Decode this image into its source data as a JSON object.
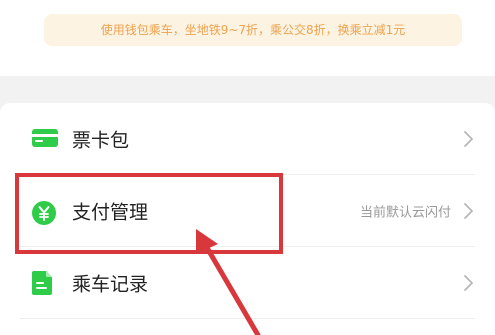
{
  "promo": {
    "text": "使用钱包乘车，坐地铁9~7折，乘公交8折，换乘立减1元"
  },
  "menu": {
    "items": [
      {
        "label": "票卡包",
        "value": "",
        "icon": "card-icon"
      },
      {
        "label": "支付管理",
        "value": "当前默认云闪付",
        "icon": "yuan-coin-icon"
      },
      {
        "label": "乘车记录",
        "value": "",
        "icon": "document-icon"
      }
    ]
  },
  "colors": {
    "highlight": "#d8373c",
    "icon_green": "#2ecc48",
    "promo_text": "#eda34e",
    "promo_bg": "#fdf3e3"
  }
}
